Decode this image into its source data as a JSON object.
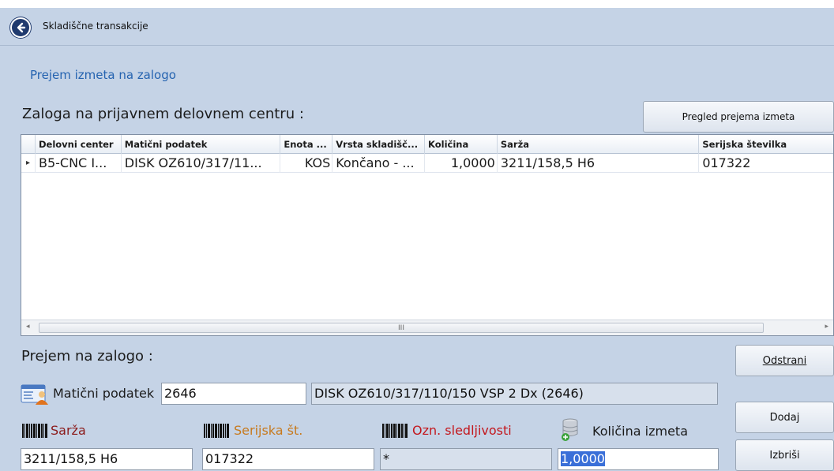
{
  "window": {
    "title": "Skladiščne transakcije"
  },
  "subtitle": "Prejem izmeta na zalogo",
  "stock_section": {
    "title": "Zaloga na prijavnem delovnem centru :"
  },
  "buttons": {
    "overview": "Pregled prejema izmeta",
    "remove": "Odstrani",
    "add": "Dodaj",
    "delete": "Izbriši"
  },
  "grid": {
    "columns": [
      "Delovni center",
      "Matični podatek",
      "Enota ...",
      "Vrsta skladišč...",
      "Količina",
      "Sarža",
      "Serijska številka"
    ],
    "rows": [
      {
        "selector": "▸",
        "cells": [
          "B5-CNC I...",
          "DISK OZ610/317/11...",
          "KOS",
          "Končano - ...",
          "1,0000",
          "3211/158,5 H6",
          "017322"
        ]
      }
    ],
    "scroll_thumb_glyph": "III"
  },
  "receipt_section": {
    "title": "Prejem na zalogo :"
  },
  "form": {
    "master_data_label": "Matični podatek",
    "master_data_value": "2646",
    "master_data_description": "DISK OZ610/317/110/150 VSP 2 Dx (2646)",
    "batch_label": "Sarža",
    "batch_value": "3211/158,5 H6",
    "serial_label": "Serijska št.",
    "serial_value": "017322",
    "trace_label": "Ozn. sledljivosti",
    "trace_value": "*",
    "qty_label": "Količina izmeta",
    "qty_value": "1,0000"
  },
  "colors": {
    "background": "#c5d3e6",
    "subtitle": "#2563b0",
    "batch_label": "#8b1a1a",
    "serial_label": "#c77a1e",
    "trace_label": "#c3171d",
    "add_button": "#fde6a6"
  },
  "icons": {
    "back": "back-arrow-icon",
    "master_data": "id-card-user-icon",
    "barcode": "barcode-icon",
    "quantity": "database-add-icon"
  }
}
